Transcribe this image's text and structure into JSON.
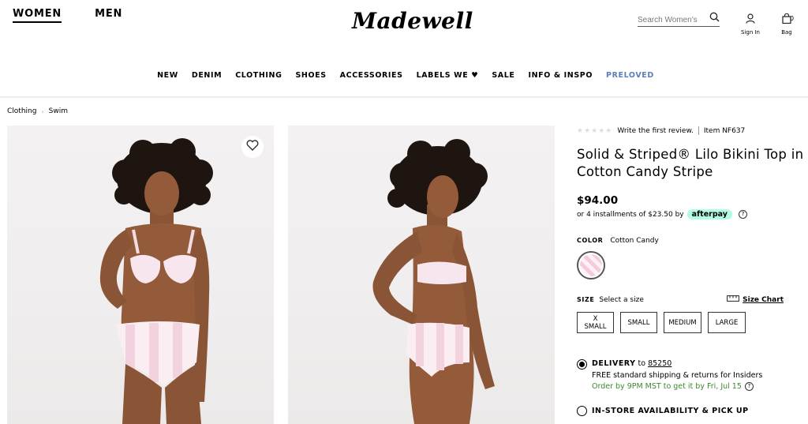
{
  "header": {
    "gender_tabs": [
      "WOMEN",
      "MEN"
    ],
    "logo": "Madewell",
    "search_placeholder": "Search Women's",
    "signin_label": "Sign In",
    "bag_label": "Bag",
    "bag_count": "0"
  },
  "nav": {
    "items": [
      "NEW",
      "DENIM",
      "CLOTHING",
      "SHOES",
      "ACCESSORIES",
      "LABELS WE",
      "SALE",
      "INFO & INSPO",
      "PRELOVED"
    ],
    "heart_glyph": "♥",
    "preloved_color": "#5b7fb8"
  },
  "breadcrumb": [
    "Clothing",
    "Swim"
  ],
  "product": {
    "stars": "★★★★★",
    "review_link": "Write the first review.",
    "item_number": "Item NF637",
    "title": "Solid & Striped® Lilo Bikini Top in Cotton Candy Stripe",
    "price": "$94.00",
    "installments": "or 4 installments of $23.50 by",
    "afterpay": "afterpay",
    "afterpay_color": "#b2fce4",
    "color_label": "COLOR",
    "color_value": "Cotton Candy",
    "size_label": "SIZE",
    "size_hint": "Select a size",
    "size_chart": "Size Chart",
    "sizes": [
      "X SMALL",
      "SMALL",
      "MEDIUM",
      "LARGE"
    ],
    "delivery": {
      "label": "DELIVERY",
      "to": "to",
      "zip": "85250",
      "free_text": "FREE standard shipping & returns for Insiders",
      "order_by": "Order by 9PM MST to get it by Fri, Jul 15",
      "order_color": "#3c8a2e"
    },
    "instore": "IN-STORE AVAILABILITY & PICK UP",
    "help_glyph": "?"
  }
}
